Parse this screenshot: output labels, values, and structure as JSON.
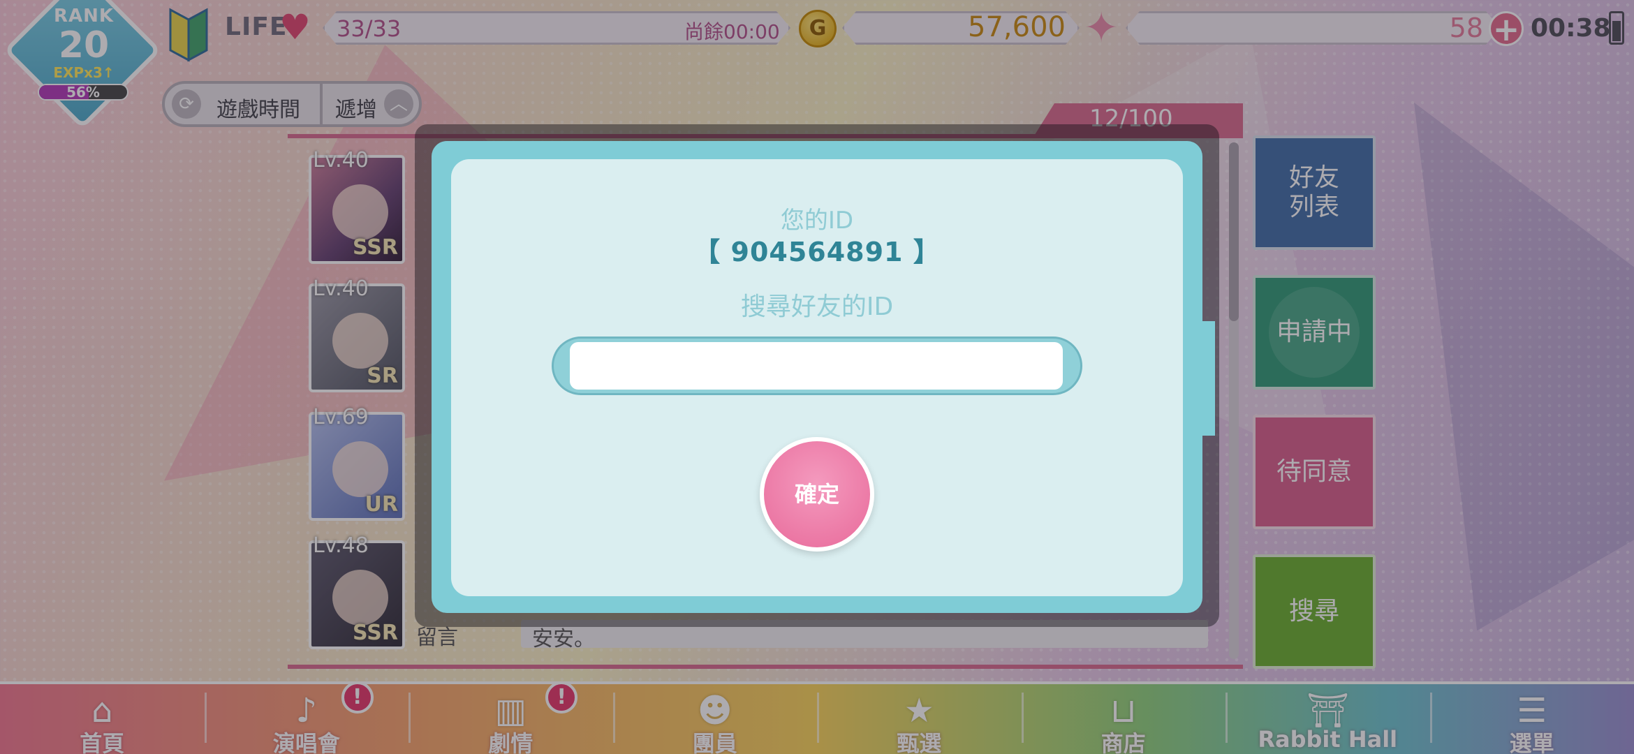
{
  "hud": {
    "rank_label": "RANK",
    "rank_value": "20",
    "exp_multiplier": "EXPx3↑",
    "exp_percent_text": "56%",
    "exp_fraction": 0.56,
    "life_label": "LIFE",
    "life_value": "33/33",
    "life_timer": "尚餘00:00",
    "coin_symbol": "G",
    "gold_value": "57,600",
    "gem_value": "58",
    "plus_symbol": "+",
    "clock": "00:38"
  },
  "sort": {
    "label": "遊戲時間",
    "order": "遞增"
  },
  "friend_list": {
    "count": "12/100",
    "friends": [
      {
        "level": "Lv.40",
        "rarity": "SSR"
      },
      {
        "level": "Lv.40",
        "rarity": "SR"
      },
      {
        "level": "Lv.69",
        "rarity": "UR"
      },
      {
        "level": "Lv.48",
        "rarity": "SSR"
      }
    ],
    "comment_label": "留言",
    "comment_text": "安安。"
  },
  "side_tabs": {
    "friends": "好友\n列表",
    "pending": "申請中",
    "waiting": "待同意",
    "search": "搜尋"
  },
  "modal": {
    "your_id_label": "您的ID",
    "your_id_value": "【  904564891  】",
    "search_label": "搜尋好友的ID",
    "search_value": "",
    "confirm_label": "確定",
    "close_symbol": "✕"
  },
  "bottom_nav": [
    {
      "label": "首頁",
      "icon": "home-icon",
      "glyph": "⌂",
      "badge": ""
    },
    {
      "label": "演唱會",
      "icon": "music-note-icon",
      "glyph": "♪",
      "badge": "!"
    },
    {
      "label": "劇情",
      "icon": "book-icon",
      "glyph": "▥",
      "badge": "!"
    },
    {
      "label": "團員",
      "icon": "member-icon",
      "glyph": "☻",
      "badge": ""
    },
    {
      "label": "甄選",
      "icon": "star-card-icon",
      "glyph": "★",
      "badge": ""
    },
    {
      "label": "商店",
      "icon": "basket-icon",
      "glyph": "⊔",
      "badge": ""
    },
    {
      "label": "Rabbit Hall",
      "icon": "hall-gate-icon",
      "glyph": "⛩",
      "badge": ""
    },
    {
      "label": "選單",
      "icon": "menu-list-icon",
      "glyph": "☰",
      "badge": ""
    }
  ],
  "colors": {
    "modal_frame": "#7fccd6",
    "modal_body": "#daeef0",
    "confirm_pink": "#e86a9a",
    "id_text": "#2f8496"
  }
}
